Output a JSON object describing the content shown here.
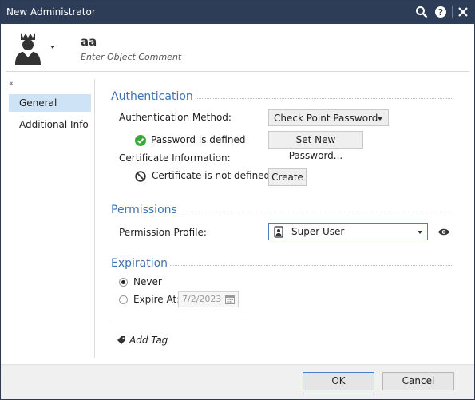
{
  "window": {
    "title": "New Administrator"
  },
  "header": {
    "object_name": "aa",
    "comment_placeholder": "Enter Object Comment"
  },
  "sidebar": {
    "collapse_glyph": "«",
    "items": [
      {
        "label": "General",
        "selected": true
      },
      {
        "label": "Additional Info",
        "selected": false
      }
    ]
  },
  "authentication": {
    "section_title": "Authentication",
    "method_label": "Authentication Method:",
    "method_value": "Check Point Password",
    "password_status": "Password is defined",
    "set_password_button": "Set New Password...",
    "certificate_label": "Certificate Information:",
    "certificate_status": "Certificate is not defined",
    "create_button": "Create"
  },
  "permissions": {
    "section_title": "Permissions",
    "profile_label": "Permission Profile:",
    "profile_value": "Super User"
  },
  "expiration": {
    "section_title": "Expiration",
    "never_label": "Never",
    "never_selected": true,
    "expire_at_label": "Expire At:",
    "expire_at_selected": false,
    "expire_date": "7/2/2023"
  },
  "tags": {
    "add_tag_label": "Add Tag"
  },
  "footer": {
    "ok_label": "OK",
    "cancel_label": "Cancel"
  },
  "colors": {
    "titlebar": "#2d3c57",
    "section_title": "#3e73b0",
    "nav_selected": "#cfe3f6",
    "success_green": "#3aa93a"
  }
}
